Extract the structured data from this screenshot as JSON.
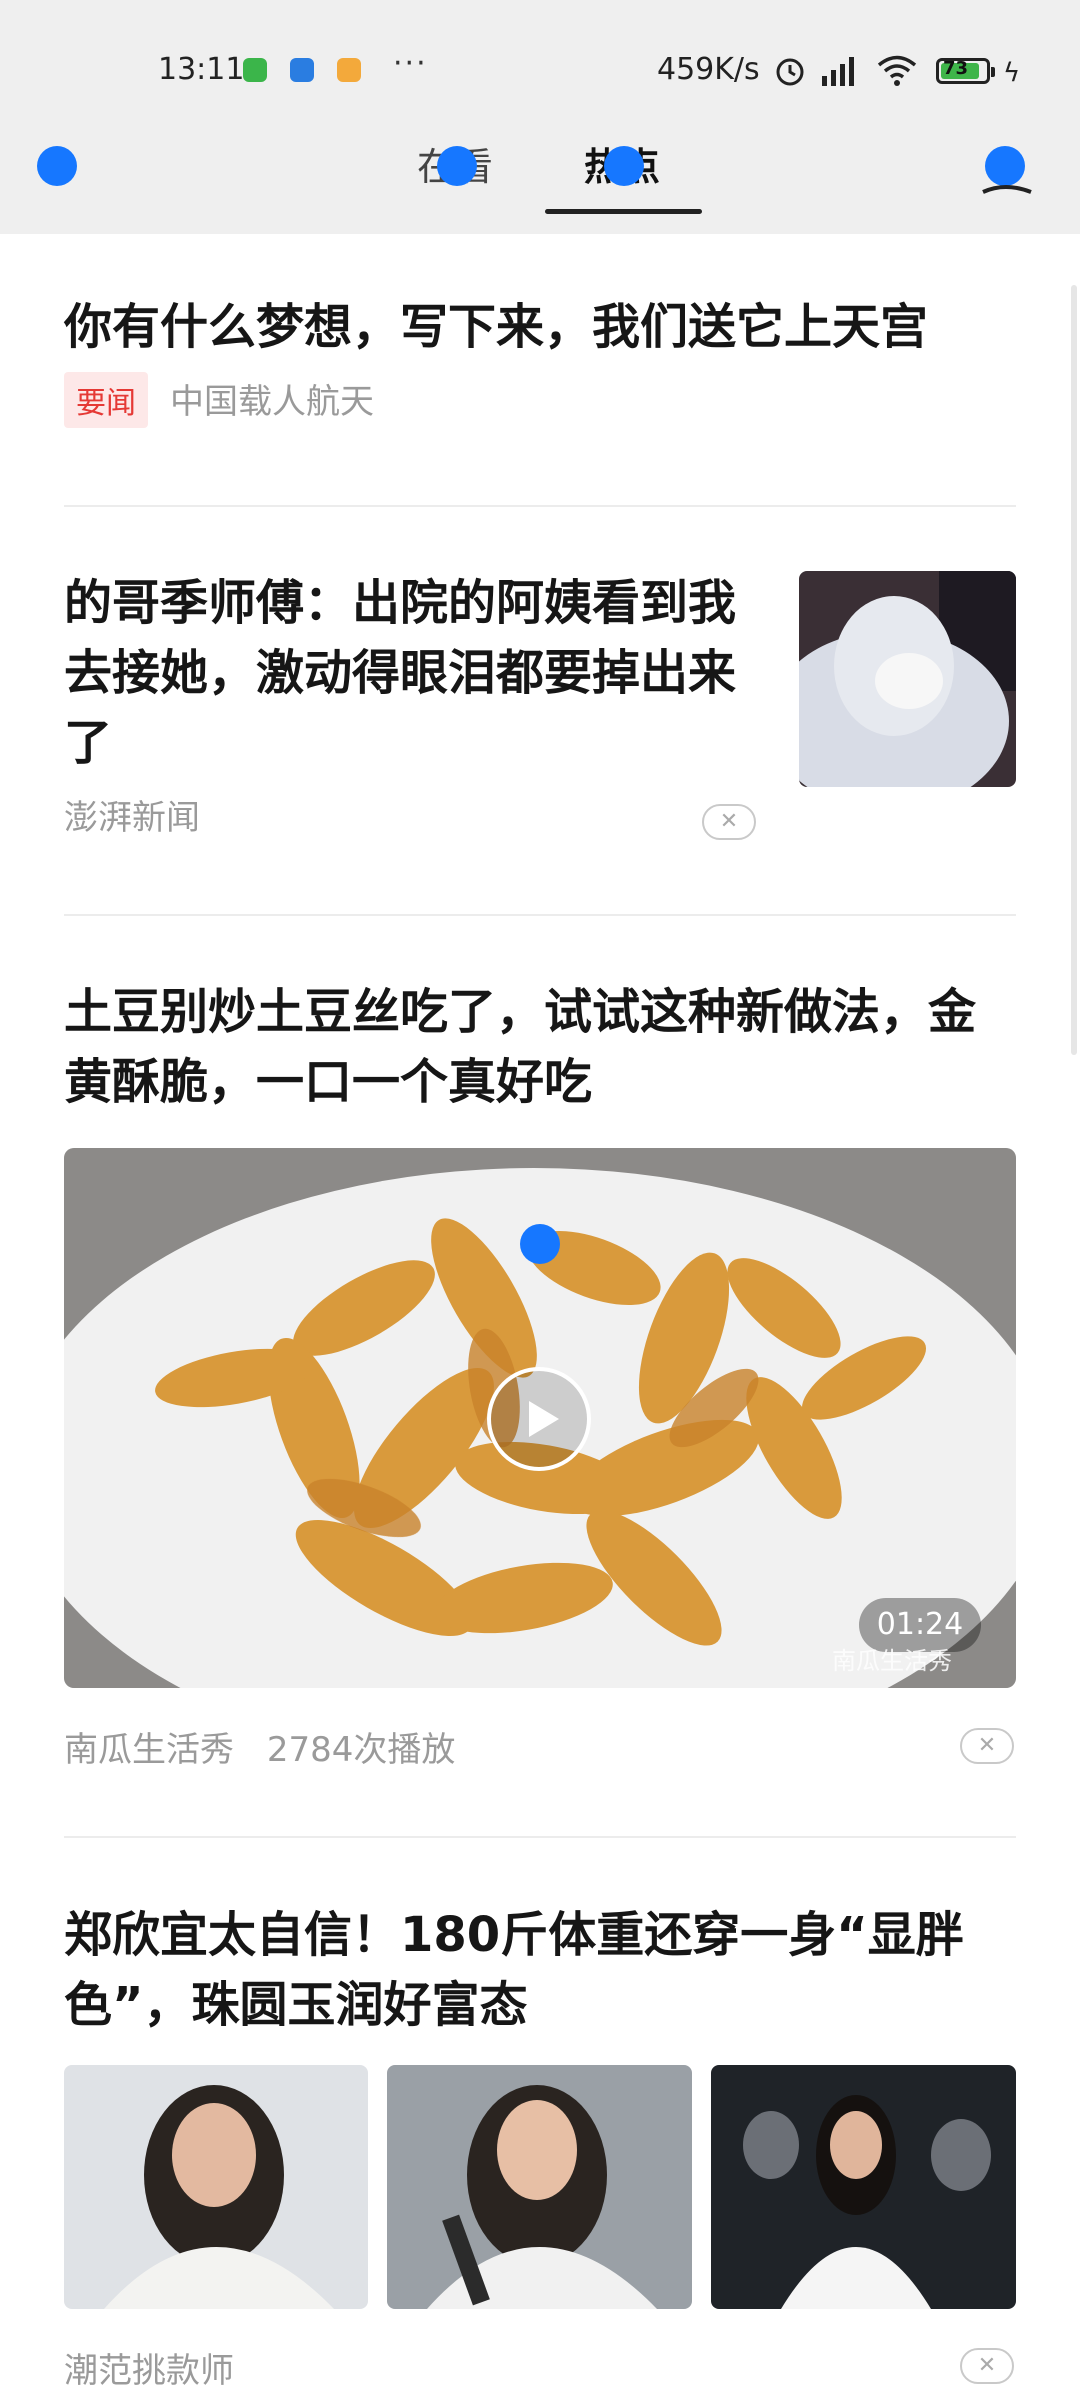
{
  "status_bar": {
    "time": "13:11",
    "dots": "···",
    "speed": "459K/s",
    "battery": "73",
    "icons": [
      "app-icon-green",
      "app-icon-blue",
      "app-icon-tiger",
      "alarm-icon",
      "hd-signal-icon",
      "wifi-icon",
      "battery-icon",
      "charging-bolt-icon"
    ]
  },
  "nav": {
    "tabs": [
      {
        "label": "在看"
      },
      {
        "label": "热点"
      }
    ]
  },
  "feed": [
    {
      "title": "你有什么梦想，写下来，我们送它上天宫",
      "tag": "要闻",
      "source": "中国载人航天"
    },
    {
      "title": "的哥季师傅：出院的阿姨看到我去接她，激动得眼泪都要掉出来了",
      "source": "澎湃新闻"
    },
    {
      "title": "土豆别炒土豆丝吃了，试试这种新做法，金黄酥脆，一口一个真好吃",
      "duration": "01:24",
      "watermark": "南瓜生活秀",
      "source": "南瓜生活秀",
      "plays": "2784次播放"
    },
    {
      "title": "郑欣宜太自信！180斤体重还穿一身“显胖色”，珠圆玉润好富态",
      "source": "潮范挑款师"
    }
  ],
  "colors": {
    "accent": "#1677ff",
    "tag_bg": "#fde8e8",
    "tag_text": "#e53935"
  }
}
